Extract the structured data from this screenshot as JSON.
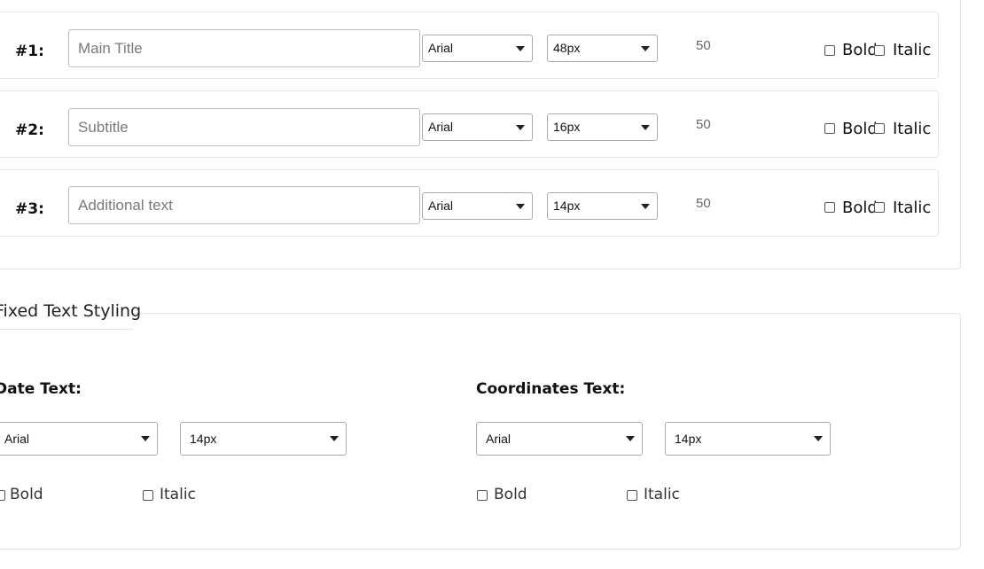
{
  "text_rows": [
    {
      "number": "#1:",
      "placeholder": "Main Title",
      "font": "Arial",
      "size": "48px",
      "max_chars": "50",
      "bold": "Bold",
      "italic": "Italic"
    },
    {
      "number": "#2:",
      "placeholder": "Subtitle",
      "font": "Arial",
      "size": "16px",
      "max_chars": "50",
      "bold": "Bold",
      "italic": "Italic"
    },
    {
      "number": "#3:",
      "placeholder": "Additional text",
      "font": "Arial",
      "size": "14px",
      "max_chars": "50",
      "bold": "Bold",
      "italic": "Italic"
    }
  ],
  "fixed_styling": {
    "legend": "Fixed Text Styling",
    "date": {
      "title": "Date Text:",
      "font": "Arial",
      "size": "14px",
      "bold": "Bold",
      "italic": "Italic"
    },
    "coordinates": {
      "title": "Coordinates Text:",
      "font": "Arial",
      "size": "14px",
      "bold": "Bold",
      "italic": "Italic"
    }
  }
}
